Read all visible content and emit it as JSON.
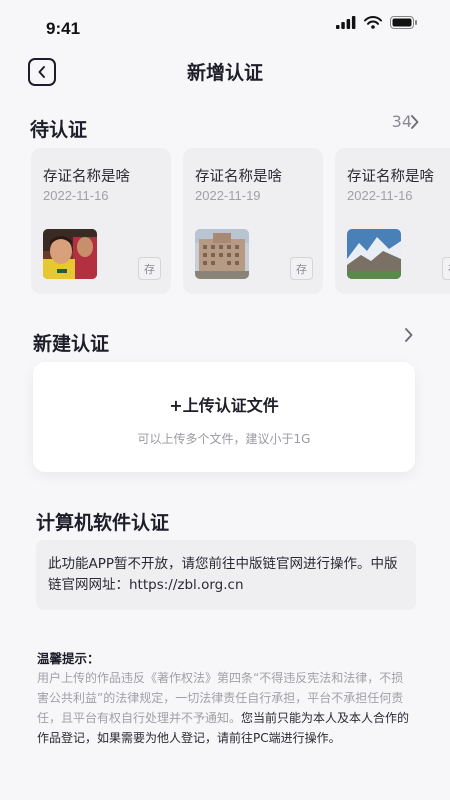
{
  "status_bar": {
    "time": "9:41"
  },
  "header": {
    "title": "新增认证"
  },
  "pending": {
    "title": "待认证",
    "count": "34",
    "cards": [
      {
        "name": "存证名称是啥",
        "date": "2022-11-16",
        "tag": "存",
        "thumb": "soccer-players-photo"
      },
      {
        "name": "存证名称是啥",
        "date": "2022-11-19",
        "tag": "存",
        "thumb": "building-photo"
      },
      {
        "name": "存证名称是啥",
        "date": "2022-11-16",
        "tag": "存",
        "thumb": "mountain-photo"
      }
    ]
  },
  "new_cert": {
    "title": "新建认证",
    "upload_label": "+上传认证文件",
    "upload_hint": "可以上传多个文件，建议小于1G"
  },
  "software_cert": {
    "title": "计算机软件认证",
    "info": "此功能APP暂不开放，请您前往中版链官网进行操作。中版链官网网址：https://zbl.org.cn"
  },
  "tips": {
    "title": "温馨提示：",
    "body_light": "用户上传的作品违反《著作权法》第四条“不得违反宪法和法律，不损害公共利益”的法律规定，一切法律责任自行承担，平台不承担任何责任，且平台有权自行处理并不予通知。",
    "body_dark": "您当前只能为本人及本人合作的作品登记，如果需要为他人登记，请前往PC端进行操作。"
  },
  "colors": {
    "background": "#f7f7f9",
    "card": "#efeff2",
    "text": "#1e1e2a",
    "muted": "#a0a0a8"
  }
}
